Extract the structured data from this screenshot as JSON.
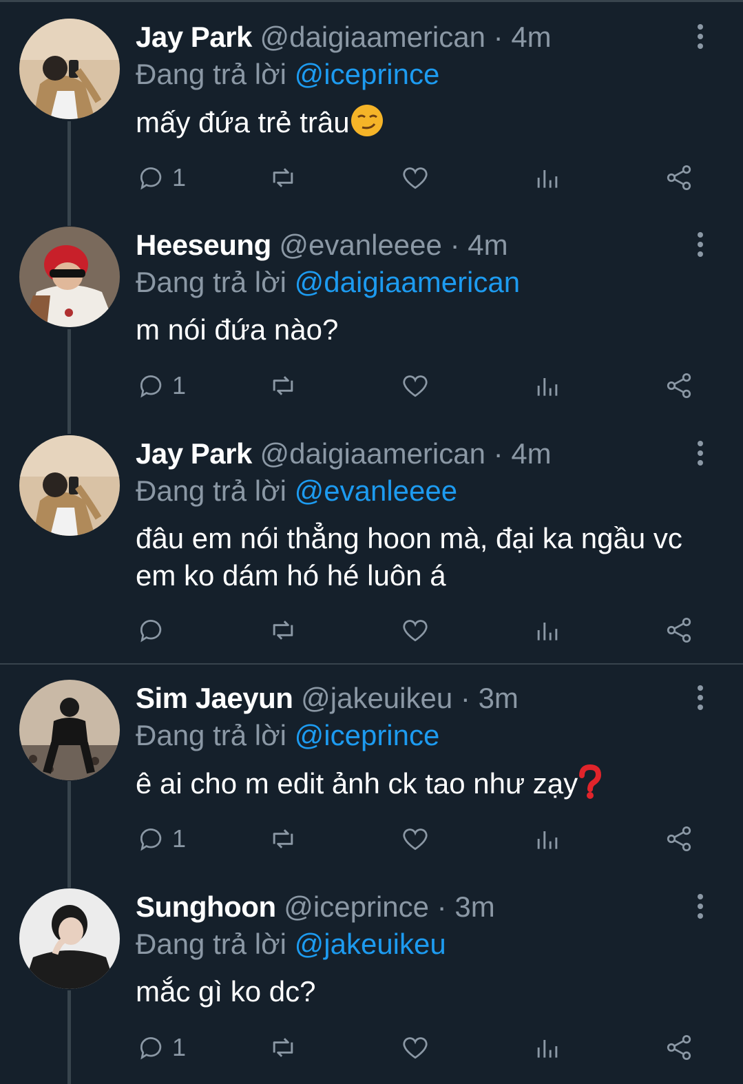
{
  "tweets": [
    {
      "name": "Jay Park",
      "handle": "@daigiaamerican",
      "time": "4m",
      "reply_prefix": "Đang trả lời",
      "reply_to": "@iceprince",
      "text": "mấy đứa trẻ trâu",
      "emoji": "smirk",
      "reply_count": "1"
    },
    {
      "name": "Heeseung",
      "handle": "@evanleeee",
      "time": "4m",
      "reply_prefix": "Đang trả lời",
      "reply_to": "@daigiaamerican",
      "text": "m nói đứa nào?",
      "reply_count": "1"
    },
    {
      "name": "Jay Park",
      "handle": "@daigiaamerican",
      "time": "4m",
      "reply_prefix": "Đang trả lời",
      "reply_to": "@evanleeee",
      "text": "đâu em nói thẳng hoon mà, đại ka ngầu vc em ko dám hó hé luôn á",
      "reply_count": ""
    },
    {
      "name": "Sim Jaeyun",
      "handle": "@jakeuikeu",
      "time": "3m",
      "reply_prefix": "Đang trả lời",
      "reply_to": "@iceprince",
      "text": "ê ai cho m edit ảnh ck tao như zạy",
      "emoji": "red-question-mark",
      "reply_count": "1"
    },
    {
      "name": "Sunghoon",
      "handle": "@iceprince",
      "time": "3m",
      "reply_prefix": "Đang trả lời",
      "reply_to": "@jakeuikeu",
      "text": "mắc gì ko dc?",
      "reply_count": "1"
    }
  ],
  "separator": "·",
  "colors": {
    "background": "#15202b",
    "secondary_text": "#8b98a5",
    "link": "#1d9bf0",
    "divider": "#38444d"
  }
}
